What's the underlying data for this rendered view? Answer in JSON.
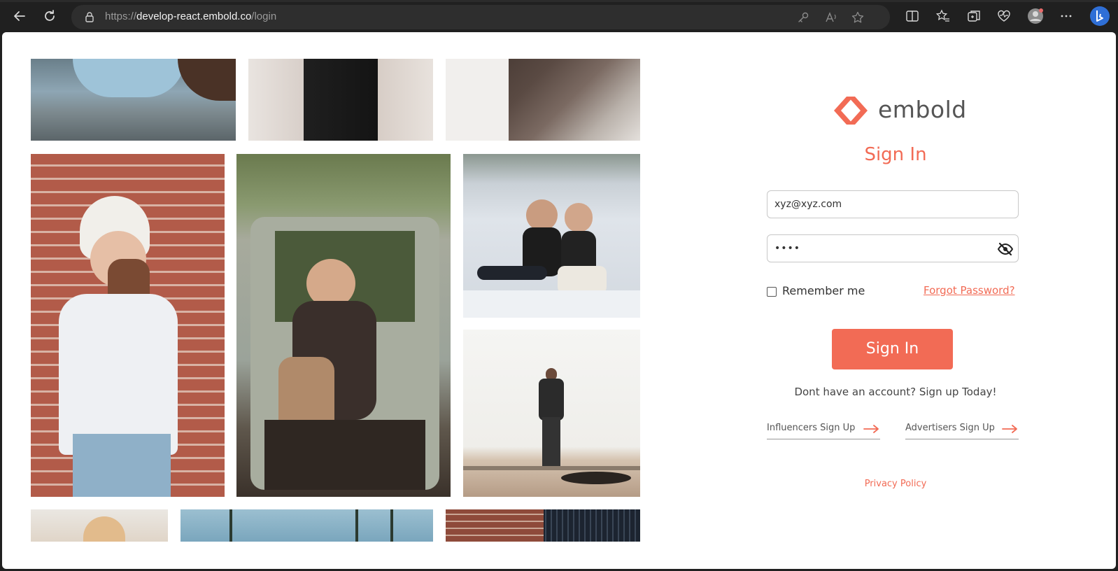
{
  "browser": {
    "url_scheme": "https://",
    "url_host": "develop-react.embold.co",
    "url_path": "/login"
  },
  "brand": {
    "name": "embold",
    "accent_color": "#f26b55"
  },
  "form": {
    "title": "Sign In",
    "email_value": "xyz@xyz.com",
    "password_value": "••••",
    "remember_label": "Remember me",
    "forgot_label": "Forgot Password?",
    "submit_label": "Sign In",
    "signup_prompt": "Dont have an account? Sign up Today!",
    "influencer_signup": "Influencers Sign Up",
    "advertiser_signup": "Advertisers Sign Up",
    "privacy_label": "Privacy Policy"
  }
}
